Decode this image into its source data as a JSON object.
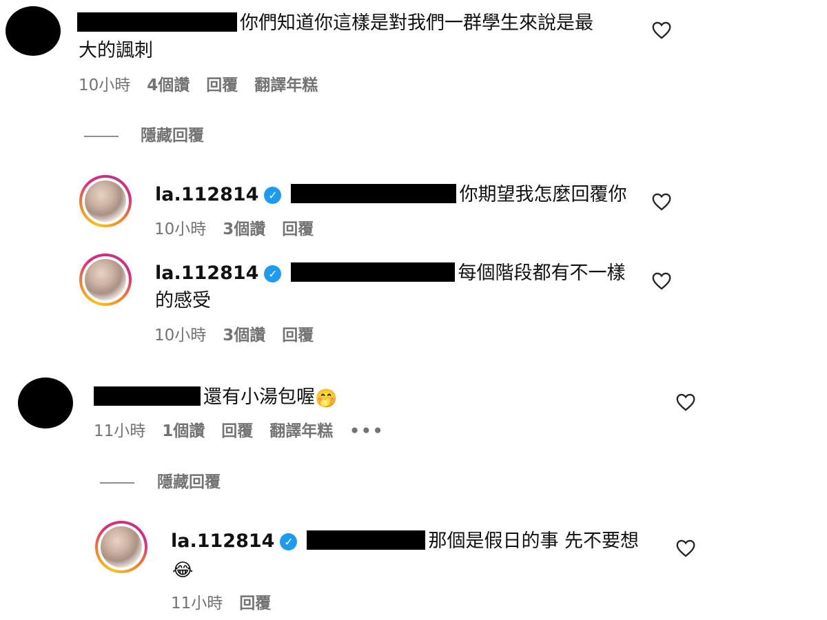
{
  "comments": [
    {
      "text_line1": "你們知道你這樣是對我們一群學生來說是最",
      "text_line2": "大的諷刺",
      "time": "10小時",
      "likes": "4個讚",
      "reply": "回覆",
      "translate": "翻譯年糕",
      "hide_replies": "隱藏回覆",
      "replies": [
        {
          "username": "la.112814",
          "text": "你期望我怎麼回覆你",
          "time": "10小時",
          "likes": "3個讚",
          "reply": "回覆"
        },
        {
          "username": "la.112814",
          "text_line1": "每個階段都有不一樣",
          "text_line2": "的感受",
          "time": "10小時",
          "likes": "3個讚",
          "reply": "回覆"
        }
      ]
    },
    {
      "text": "還有小湯包喔",
      "emoji": "🤭",
      "time": "11小時",
      "likes": "1個讚",
      "reply": "回覆",
      "translate": "翻譯年糕",
      "more": "•••",
      "hide_replies": "隱藏回覆",
      "replies": [
        {
          "username": "la.112814",
          "text": "那個是假日的事 先不要想",
          "emoji": "😂",
          "time": "11小時",
          "reply": "回覆"
        }
      ]
    }
  ],
  "icons": {
    "verified": "verified-badge-icon",
    "like": "heart-outline-icon"
  },
  "colors": {
    "verified": "#1d9bf0",
    "meta_text": "#737373"
  }
}
